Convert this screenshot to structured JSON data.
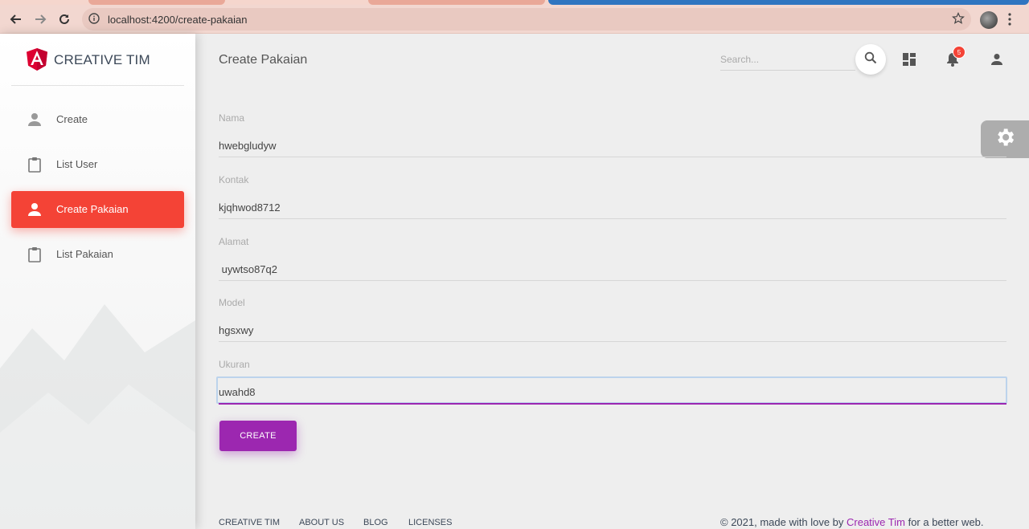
{
  "browser": {
    "url": "localhost:4200/create-pakaian"
  },
  "sidebar": {
    "brand_name": "CREATIVE TIM",
    "items": [
      {
        "label": "Create",
        "icon": "person-icon",
        "active": false
      },
      {
        "label": "List User",
        "icon": "clipboard-icon",
        "active": false
      },
      {
        "label": "Create Pakaian",
        "icon": "person-icon",
        "active": true
      },
      {
        "label": "List Pakaian",
        "icon": "clipboard-icon",
        "active": false
      }
    ]
  },
  "header": {
    "title": "Create Pakaian",
    "search_placeholder": "Search...",
    "notification_count": "5"
  },
  "form": {
    "fields": [
      {
        "label": "Nama",
        "value": "hwebgludyw"
      },
      {
        "label": "Kontak",
        "value": "kjqhwod8712"
      },
      {
        "label": "Alamat",
        "value": " uywtso87q2"
      },
      {
        "label": "Model",
        "value": "hgsxwy"
      },
      {
        "label": "Ukuran",
        "value": "uwahd8"
      }
    ],
    "submit_label": "CREATE"
  },
  "footer": {
    "links": [
      "CREATIVE TIM",
      "ABOUT US",
      "BLOG",
      "LICENSES"
    ],
    "copyright_prefix": "© 2021, made with love by ",
    "copyright_brand": "Creative Tim",
    "copyright_suffix": " for a better web."
  },
  "colors": {
    "accent": "#9c27b0",
    "active_nav": "#f44336",
    "badge": "#f44336"
  }
}
